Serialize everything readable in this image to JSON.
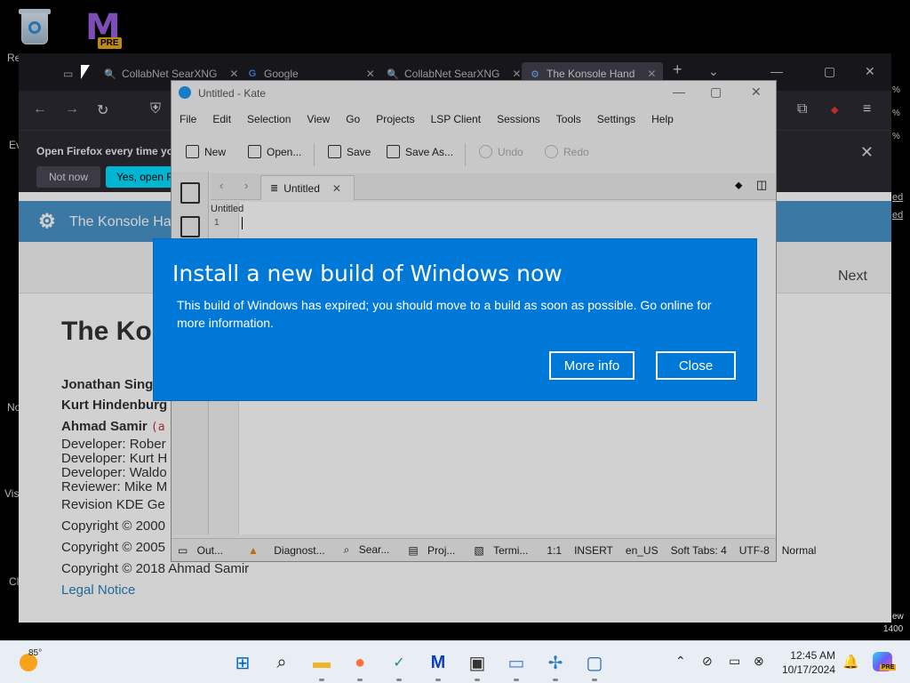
{
  "desktop": {
    "icons": [
      {
        "label": "Re"
      },
      {
        "label": "PRE"
      }
    ],
    "edge_labels": [
      "Ev",
      "No",
      "Vis",
      "Cl"
    ]
  },
  "firefox": {
    "tabs": [
      {
        "title": "CollabNet SearXNG",
        "icon": "searxng-icon"
      },
      {
        "title": "Google",
        "icon": "google-icon"
      },
      {
        "title": "CollabNet SearXNG",
        "icon": "searxng-icon"
      },
      {
        "title": "The Konsole Hand",
        "icon": "kde-icon"
      }
    ],
    "new_tab": "+",
    "notification": {
      "text": "Open Firefox every time yo",
      "not_now": "Not now",
      "yes": "Yes, open F"
    },
    "page": {
      "banner_title": "The Konsole Ha",
      "next_label": "Next",
      "doc_title": "The Ko",
      "authors": [
        "Jonathan Sing",
        "Kurt Hindenburg",
        "Ahmad Samir"
      ],
      "author_suffix": "(a",
      "roles": [
        "Developer: Rober",
        "Developer: Kurt H",
        "Developer: Waldo",
        "Reviewer: Mike M"
      ],
      "revision": "Revision KDE Ge",
      "copyrights": [
        "Copyright © 2000",
        "Copyright © 2005",
        "Copyright © 2018 Ahmad Samir"
      ],
      "legal": "Legal Notice"
    },
    "right_edge": [
      "%",
      "%",
      "%",
      "ed",
      "ed"
    ]
  },
  "kate": {
    "title": "Untitled  - Kate",
    "menu": [
      "File",
      "Edit",
      "Selection",
      "View",
      "Go",
      "Projects",
      "LSP Client",
      "Sessions",
      "Tools",
      "Settings",
      "Help"
    ],
    "toolbar": {
      "new": "New",
      "open": "Open...",
      "save": "Save",
      "save_as": "Save As...",
      "undo": "Undo",
      "redo": "Redo"
    },
    "tab_label": "Untitled",
    "doc_label": "Untitled",
    "line_number": "1",
    "status": [
      "Out...",
      "Diagnost...",
      "Sear...",
      "Proj...",
      "Termi...",
      "1:1",
      "INSERT",
      "en_US",
      "Soft Tabs: 4",
      "UTF-8",
      "Normal"
    ]
  },
  "dialog": {
    "title": "Install a new build of Windows now",
    "message": "This build of Windows has expired; you should move to a build as soon as possible. Go online for more information.",
    "more_info": "More info",
    "close": "Close"
  },
  "taskbar": {
    "temperature": "85°",
    "time": "12:45 AM",
    "date": "10/17/2024",
    "right_edge": [
      "ew",
      "1400"
    ],
    "pre_badge": "PRE"
  },
  "colors": {
    "dialog_bg": "#0078d7",
    "kde_banner": "#4a93c9",
    "firefox_dark": "#1c1b22",
    "taskbar": "#e9eef5"
  }
}
